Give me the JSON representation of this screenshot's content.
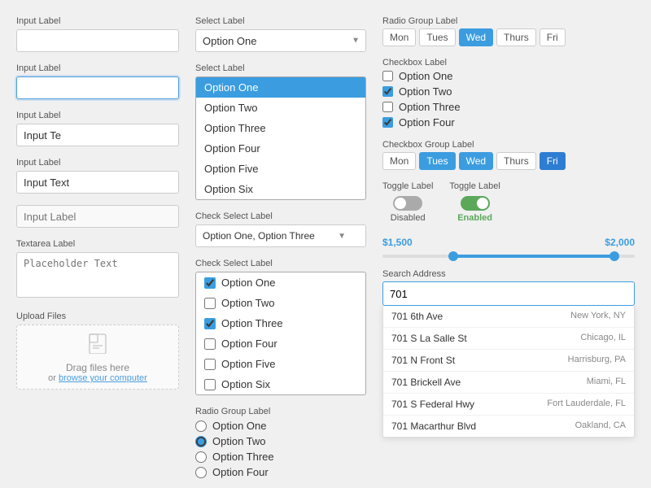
{
  "col1": {
    "field1": {
      "label": "Input Label",
      "placeholder": "",
      "value": ""
    },
    "field2": {
      "label": "Input Label",
      "placeholder": "",
      "value": "",
      "focused": true
    },
    "field3": {
      "label": "Input Label",
      "placeholder": "",
      "value": "Input Te"
    },
    "field4": {
      "label": "Input Label",
      "placeholder": "",
      "value": "Input Text"
    },
    "field5": {
      "label": "Input Label",
      "placeholder": "Input Label",
      "value": ""
    },
    "textarea": {
      "label": "Textarea Label",
      "placeholder": "Placeholder Text"
    },
    "upload": {
      "label": "Upload Files",
      "drag_text": "Drag files here",
      "or_text": "or",
      "browse_text": "browse your computer"
    }
  },
  "col2": {
    "select1": {
      "label": "Select Label",
      "value": "Option One",
      "options": [
        "Option One",
        "Option Two",
        "Option Three",
        "Option Four",
        "Option Five",
        "Option Six"
      ]
    },
    "select2": {
      "label": "Select Label",
      "open": true,
      "selected": "Option One",
      "options": [
        "Option One",
        "Option Two",
        "Option Three",
        "Option Four",
        "Option Five",
        "Option Six"
      ]
    },
    "checkSelect1": {
      "label": "Check Select Label",
      "value": "Option One, Option Three",
      "options": [
        {
          "label": "Option One",
          "checked": true
        },
        {
          "label": "Option Two",
          "checked": false
        },
        {
          "label": "Option Three",
          "checked": true
        },
        {
          "label": "Option Four",
          "checked": false
        },
        {
          "label": "Option Five",
          "checked": false
        },
        {
          "label": "Option Six",
          "checked": false
        }
      ]
    },
    "radioGroup": {
      "label": "Radio Group Label",
      "options": [
        "Option One",
        "Option Two",
        "Option Three",
        "Option Four"
      ],
      "selected": "Option Two"
    }
  },
  "col3": {
    "radioGroupLabel": {
      "label": "Radio Group Label",
      "tags": [
        "Mon",
        "Tues",
        "Wed",
        "Thurs",
        "Fri"
      ],
      "active": "Wed"
    },
    "checkboxLabel": {
      "label": "Checkbox Label",
      "items": [
        {
          "label": "Option One",
          "checked": false
        },
        {
          "label": "Option Two",
          "checked": true
        },
        {
          "label": "Option Three",
          "checked": false
        },
        {
          "label": "Option Four",
          "checked": true
        }
      ]
    },
    "checkboxGroupLabel": {
      "label": "Checkbox Group Label",
      "tags": [
        "Mon",
        "Tues",
        "Wed",
        "Thurs",
        "Fri"
      ],
      "active": [
        "Tues",
        "Wed",
        "Fri"
      ]
    },
    "toggle": {
      "label": "Toggle Label",
      "items": [
        {
          "label_top": "Toggle Label",
          "state": "off",
          "label_bottom": "Disabled"
        },
        {
          "label_top": "Toggle Label",
          "state": "on",
          "label_bottom": "Enabled"
        }
      ]
    },
    "range": {
      "label": "",
      "min_label": "$1,500",
      "max_label": "$2,000",
      "fill_left_pct": 30,
      "fill_right_pct": 10
    },
    "search": {
      "label": "Search Address",
      "value": "701",
      "results": [
        {
          "main": "701 6th Ave",
          "sub": "New York, NY"
        },
        {
          "main": "701 S La Salle St",
          "sub": "Chicago, IL"
        },
        {
          "main": "701 N Front St",
          "sub": "Harrisburg, PA"
        },
        {
          "main": "701 Brickell Ave",
          "sub": "Miami, FL"
        },
        {
          "main": "701 S Federal Hwy",
          "sub": "Fort Lauderdale, FL"
        },
        {
          "main": "701 Macarthur Blvd",
          "sub": "Oakland, CA"
        }
      ]
    }
  }
}
